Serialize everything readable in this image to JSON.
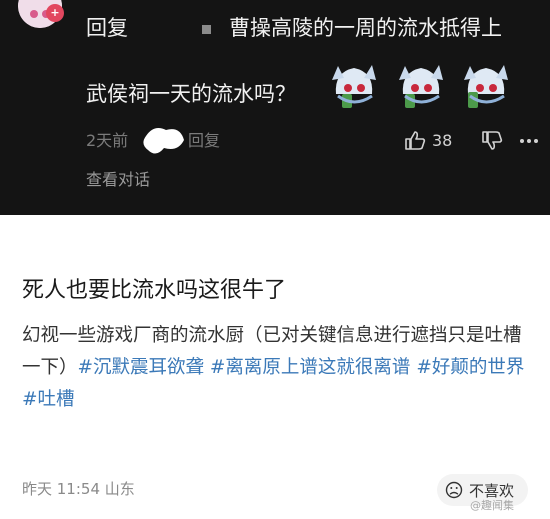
{
  "comment": {
    "badge_text": "+",
    "reply_label": "回复",
    "reply_text_line1": "曹操高陵的一周的流水抵得上",
    "reply_text_line2": "武侯祠一天的流水吗？",
    "time": "2天前",
    "reply_button": "回复",
    "like_count": "38",
    "view_conversation": "查看对话",
    "icons": [
      "avatar",
      "thumbs-up-icon",
      "thumbs-down-icon",
      "more-icon",
      "sticker"
    ]
  },
  "post": {
    "title": "死人也要比流水吗这很牛了",
    "body_text": "幻视一些游戏厂商的流水厨（已对关键信息进行遮挡只是吐槽一下）",
    "hashtags": [
      "#沉默震耳欲聋",
      "#离离原上谱这就很离谱",
      "#好颠的世界",
      "#吐槽"
    ],
    "time": "昨天 11:54",
    "location": "山东",
    "dislike_label": "不喜欢",
    "watermark": "@趣闻集"
  },
  "colors": {
    "dark_bg": "#141414",
    "hashtag": "#3b79b8"
  }
}
